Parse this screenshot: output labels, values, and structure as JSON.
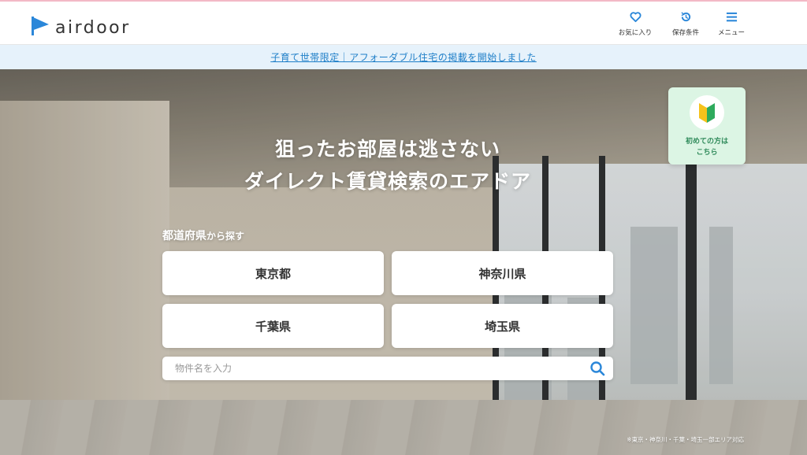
{
  "header": {
    "logo_text": "airdoor",
    "brand_color": "#2b87d9",
    "nav": [
      {
        "label": "お気に入り",
        "icon": "heart-icon"
      },
      {
        "label": "保存条件",
        "icon": "history-icon"
      },
      {
        "label": "メニュー",
        "icon": "menu-icon"
      }
    ]
  },
  "notice": {
    "text": "子育て世帯限定｜アフォーダブル住宅の掲載を開始しました",
    "color": "#1f7fc8"
  },
  "hero": {
    "headline_1": "狙ったお部屋は逃さない",
    "headline_2": "ダイレクト賃貸検索のエアドア",
    "first_time": {
      "line1": "初めての方は",
      "line2": "こちら",
      "icon": "beginner-mark-icon"
    },
    "search_by_pref": {
      "main": "都道府県",
      "suffix": "から探す"
    },
    "prefectures": [
      "東京都",
      "神奈川県",
      "千葉県",
      "埼玉県"
    ],
    "search": {
      "placeholder": "物件名を入力",
      "icon": "search-icon"
    },
    "footnote": "※東京・神奈川・千葉・埼玉一部エリア対応"
  }
}
